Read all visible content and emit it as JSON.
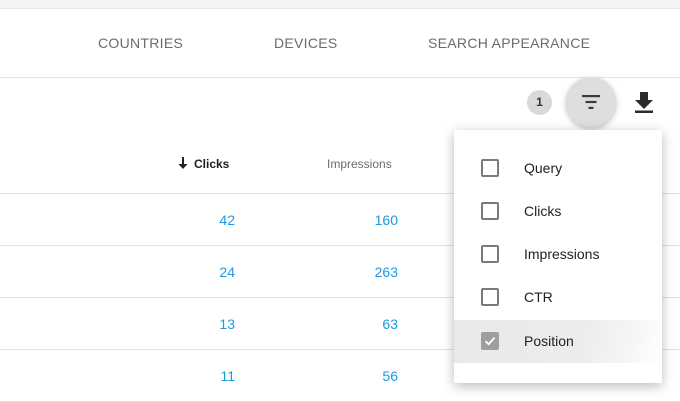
{
  "tabs": [
    {
      "label": "COUNTRIES"
    },
    {
      "label": "DEVICES"
    },
    {
      "label": "SEARCH APPEARANCE"
    }
  ],
  "toolbar": {
    "filter_count": "1",
    "filter_icon": "filter-icon",
    "download_icon": "download-icon"
  },
  "table": {
    "columns": [
      {
        "label": "Clicks",
        "sorted": "descending",
        "icon": "arrow-down-icon"
      },
      {
        "label": "Impressions"
      }
    ],
    "rows": [
      {
        "clicks": "42",
        "impressions": "160"
      },
      {
        "clicks": "24",
        "impressions": "263"
      },
      {
        "clicks": "13",
        "impressions": "63"
      },
      {
        "clicks": "11",
        "impressions": "56"
      }
    ]
  },
  "column_menu": {
    "items": [
      {
        "label": "Query",
        "checked": false
      },
      {
        "label": "Clicks",
        "checked": false
      },
      {
        "label": "Impressions",
        "checked": false
      },
      {
        "label": "CTR",
        "checked": false
      },
      {
        "label": "Position",
        "checked": true
      }
    ]
  },
  "colors": {
    "link_value": "#1a9be0",
    "muted_text": "#6b6b6b",
    "selected_row": "#e9e9e9"
  }
}
